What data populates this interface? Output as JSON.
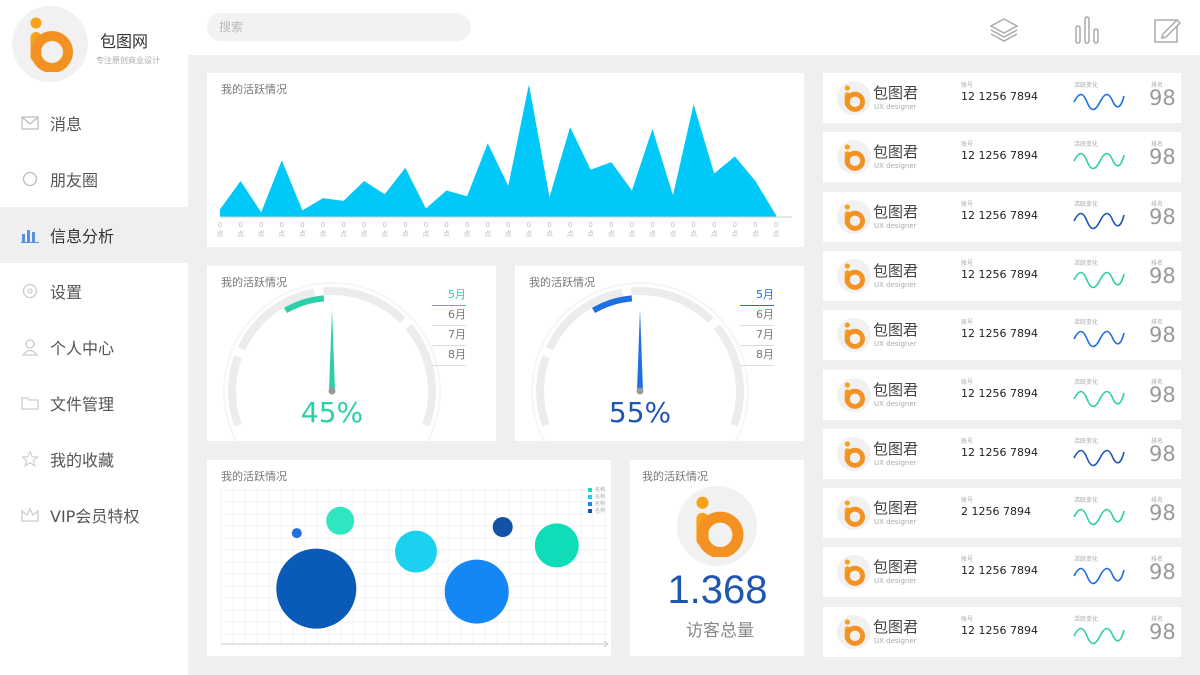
{
  "brand": {
    "name": "包图网",
    "tagline": "专注原创商业设计"
  },
  "search": {
    "placeholder": "搜索"
  },
  "nav": [
    {
      "label": "消息",
      "icon": "mail-icon",
      "active": false
    },
    {
      "label": "朋友圈",
      "icon": "circle-icon",
      "active": false
    },
    {
      "label": "信息分析",
      "icon": "bar-chart-icon",
      "active": true
    },
    {
      "label": "设置",
      "icon": "gear-icon",
      "active": false
    },
    {
      "label": "个人中心",
      "icon": "user-icon",
      "active": false
    },
    {
      "label": "文件管理",
      "icon": "folder-icon",
      "active": false
    },
    {
      "label": "我的收藏",
      "icon": "star-icon",
      "active": false
    },
    {
      "label": "VIP会员特权",
      "icon": "crown-icon",
      "active": false
    }
  ],
  "topbar": {
    "icons": [
      "layers-icon",
      "bars-icon",
      "edit-icon"
    ]
  },
  "colors": {
    "accent_cyan": "#00c8f8",
    "green": "#2ecfa8",
    "blue": "#1f6fe0",
    "dark_blue": "#1f56b0",
    "logo_orange": "#f7a21b"
  },
  "area_card": {
    "title": "我的活跃情况",
    "tick_label": "0点"
  },
  "gauge1": {
    "title": "我的活跃情况",
    "value": "45%",
    "months": [
      "5月",
      "6月",
      "7月",
      "8月"
    ],
    "selected": "5月",
    "color": "#2ecfa8"
  },
  "gauge2": {
    "title": "我的活跃情况",
    "value": "55%",
    "months": [
      "5月",
      "6月",
      "7月",
      "8月"
    ],
    "selected": "5月",
    "color": "#1f6fe0"
  },
  "bubble_card": {
    "title": "我的活跃情况",
    "legend": [
      "名称",
      "名称",
      "名称",
      "名称"
    ]
  },
  "visitor_card": {
    "title": "我的活跃情况",
    "number": "1.368",
    "label": "访客总量"
  },
  "users": [
    {
      "name": "包图君",
      "role": "UX designer",
      "account_label": "账号",
      "account": "12 1256 7894",
      "activity_label": "活跃变化",
      "rank_label": "排名",
      "rank": "98",
      "wave_color": "#1f6fe0"
    },
    {
      "name": "包图君",
      "role": "UX designer",
      "account_label": "账号",
      "account": "12 1256 7894",
      "activity_label": "活跃变化",
      "rank_label": "排名",
      "rank": "98",
      "wave_color": "#2ecfa8"
    },
    {
      "name": "包图君",
      "role": "UX designer",
      "account_label": "账号",
      "account": "12 1256 7894",
      "activity_label": "活跃变化",
      "rank_label": "排名",
      "rank": "98",
      "wave_color": "#1f56b0"
    },
    {
      "name": "包图君",
      "role": "UX designer",
      "account_label": "账号",
      "account": "12 1256 7894",
      "activity_label": "活跃变化",
      "rank_label": "排名",
      "rank": "98",
      "wave_color": "#2ecfa8"
    },
    {
      "name": "包图君",
      "role": "UX designer",
      "account_label": "账号",
      "account": "12 1256 7894",
      "activity_label": "活跃变化",
      "rank_label": "排名",
      "rank": "98",
      "wave_color": "#1f6fe0"
    },
    {
      "name": "包图君",
      "role": "UX designer",
      "account_label": "账号",
      "account": "12 1256 7894",
      "activity_label": "活跃变化",
      "rank_label": "排名",
      "rank": "98",
      "wave_color": "#2ecfa8"
    },
    {
      "name": "包图君",
      "role": "UX designer",
      "account_label": "账号",
      "account": "12 1256 7894",
      "activity_label": "活跃变化",
      "rank_label": "排名",
      "rank": "98",
      "wave_color": "#1f56b0"
    },
    {
      "name": "包图君",
      "role": "UX designer",
      "account_label": "账号",
      "account": "2 1256 7894",
      "activity_label": "活跃变化",
      "rank_label": "排名",
      "rank": "98",
      "wave_color": "#2ecfa8"
    },
    {
      "name": "包图君",
      "role": "UX designer",
      "account_label": "账号",
      "account": "12 1256 7894",
      "activity_label": "活跃变化",
      "rank_label": "排名",
      "rank": "98",
      "wave_color": "#1f6fe0"
    },
    {
      "name": "包图君",
      "role": "UX designer",
      "account_label": "账号",
      "account": "12 1256 7894",
      "activity_label": "活跃变化",
      "rank_label": "排名",
      "rank": "98",
      "wave_color": "#2ecfa8"
    }
  ],
  "chart_data": [
    {
      "type": "area",
      "title": "我的活跃情况",
      "categories": [
        "0点",
        "0点",
        "0点",
        "0点",
        "0点",
        "0点",
        "0点",
        "0点",
        "0点",
        "0点",
        "0点",
        "0点",
        "0点",
        "0点",
        "0点",
        "0点",
        "0点",
        "0点",
        "0点",
        "0点",
        "0点",
        "0点",
        "0点",
        "0点",
        "0点",
        "0点",
        "0点",
        "0点"
      ],
      "series": [
        {
          "values": [
            8,
            38,
            5,
            60,
            7,
            20,
            17,
            38,
            24,
            52,
            9,
            28,
            22,
            78,
            33,
            140,
            21,
            95,
            50,
            58,
            28,
            93,
            23,
            119,
            46,
            64,
            38,
            2
          ]
        }
      ],
      "ylim": [
        0,
        150
      ],
      "color": "#00c8f8",
      "grid": false
    },
    {
      "type": "gauge",
      "title": "我的活跃情况",
      "value": 45,
      "unit": "%",
      "categories": [
        "5月",
        "6月",
        "7月",
        "8月"
      ],
      "selected": "5月",
      "color": "#2ecfa8"
    },
    {
      "type": "gauge",
      "title": "我的活跃情况",
      "value": 55,
      "unit": "%",
      "categories": [
        "5月",
        "6月",
        "7月",
        "8月"
      ],
      "selected": "5月",
      "color": "#1f6fe0"
    },
    {
      "type": "scatter",
      "title": "我的活跃情况",
      "bubbles": [
        {
          "x": 35,
          "y": 72,
          "size": 5,
          "color": "#1f6fe0"
        },
        {
          "x": 55,
          "y": 80,
          "size": 14,
          "color": "#2ee6c0"
        },
        {
          "x": 44,
          "y": 36,
          "size": 40,
          "color": "#0a5ab8"
        },
        {
          "x": 90,
          "y": 60,
          "size": 21,
          "color": "#1ad2f0"
        },
        {
          "x": 118,
          "y": 34,
          "size": 32,
          "color": "#1487f5"
        },
        {
          "x": 130,
          "y": 76,
          "size": 10,
          "color": "#1252a8"
        },
        {
          "x": 155,
          "y": 64,
          "size": 22,
          "color": "#10dcb8"
        }
      ],
      "legend": [
        "名称",
        "名称",
        "名称",
        "名称"
      ],
      "legend_colors": [
        "#10dcb8",
        "#1ad2f0",
        "#1487f5",
        "#1252a8"
      ],
      "legend_position": "top-right",
      "xlim": [
        0,
        180
      ],
      "ylim": [
        0,
        100
      ],
      "grid": true
    }
  ]
}
